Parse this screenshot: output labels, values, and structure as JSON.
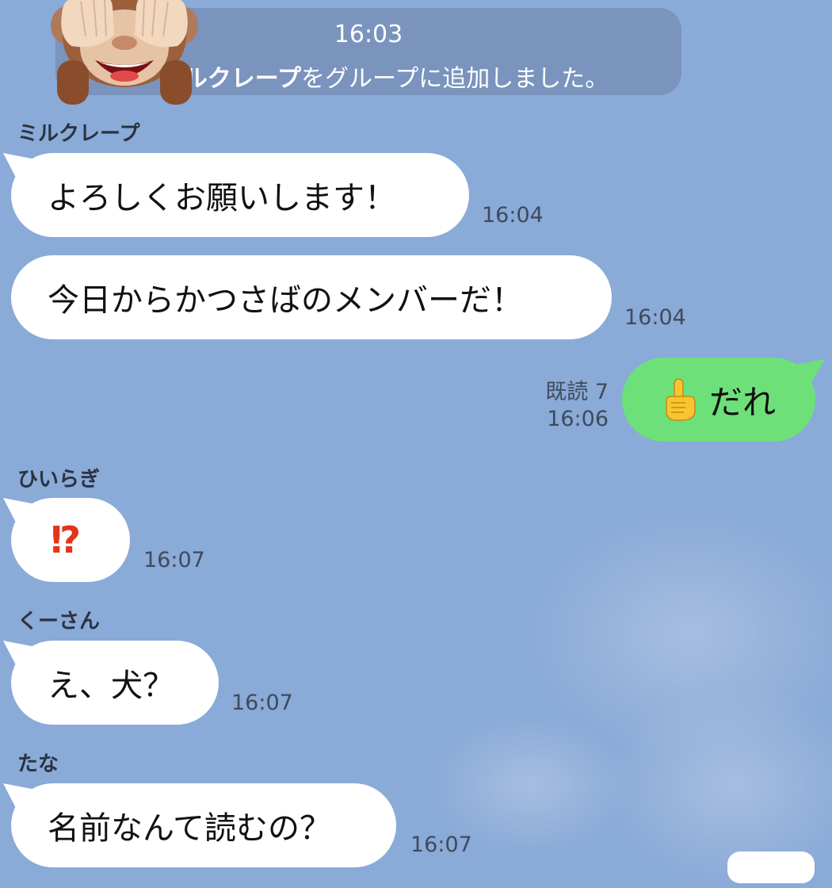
{
  "system": {
    "time": "16:03",
    "added_name": "ミルクレープ",
    "added_suffix": "をグループに追加しました。",
    "monkey_icon": "see-no-evil-monkey-icon"
  },
  "messages": [
    {
      "sender": "ミルクレープ",
      "text": "よろしくお願いします！",
      "time": "16:04"
    },
    {
      "text": "今日からかつさばのメンバーだ！",
      "time": "16:04"
    },
    {
      "sender": "ひいらぎ",
      "text": "⁉",
      "time": "16:07"
    },
    {
      "sender": "くーさん",
      "text": "え、犬？",
      "time": "16:07"
    },
    {
      "sender": "たな",
      "text": "名前なんて読むの？",
      "time": "16:07"
    }
  ],
  "my_message": {
    "icon": "pointing-up-finger-icon",
    "text": "だれ",
    "read_label": "既読 7",
    "time": "16:06"
  },
  "colors": {
    "background": "#8aaad8",
    "incoming_bubble": "#ffffff",
    "outgoing_bubble": "#6ee07a",
    "exclaim": "#e2351b"
  }
}
